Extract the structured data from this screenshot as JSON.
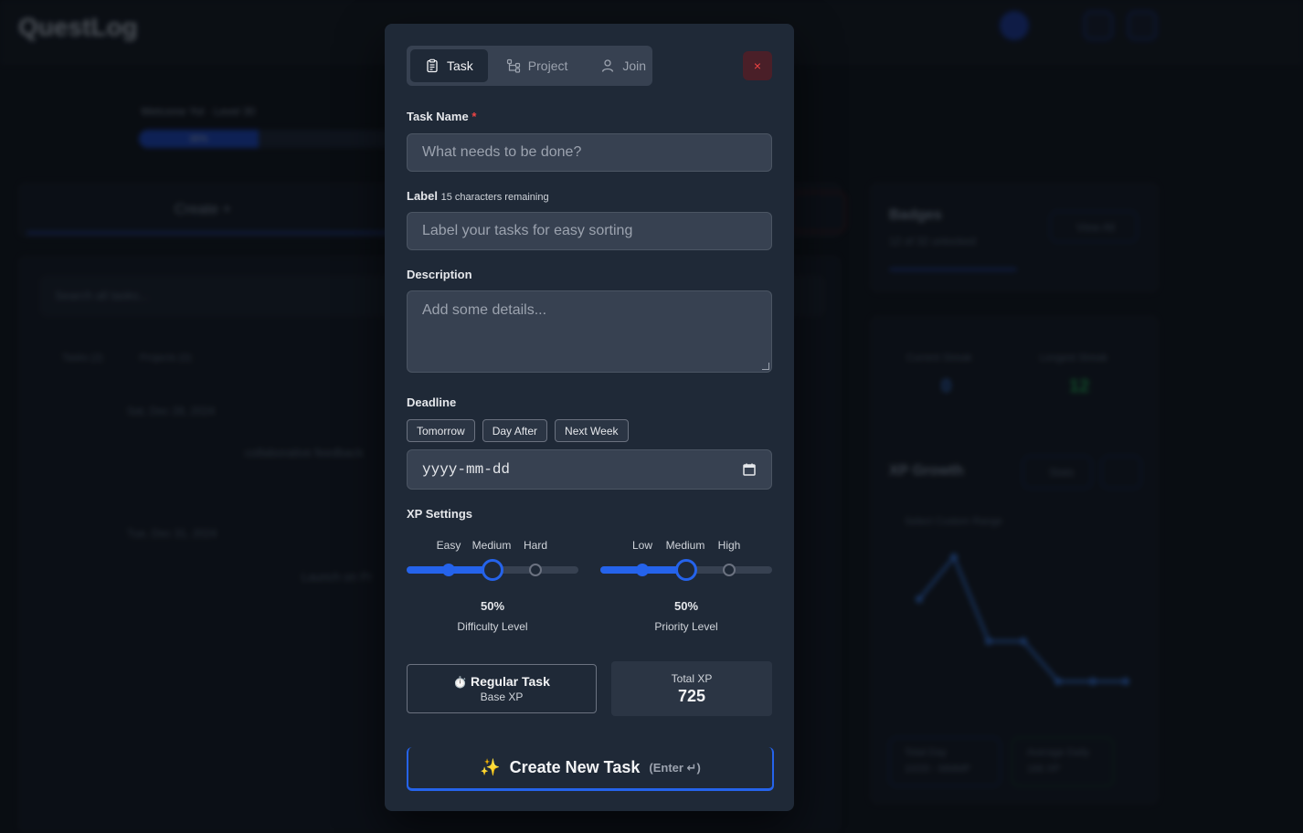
{
  "background": {
    "app_title": "QuestLog",
    "welcome_text": "Welcome Yol · Level 30",
    "progress_text": "36%",
    "create_tab": "Create +",
    "search_placeholder": "Search all tasks...",
    "filter_tasks": "Tasks (2)",
    "filter_projects": "Projects (0)",
    "date_1": "Sat, Dec 28, 2024",
    "task_1": "collaborative feedback",
    "date_2": "Tue, Dec 31, 2024",
    "task_2": "Launch on Pr",
    "badges_title": "Badges",
    "badges_sub": "12 of 32 unlocked",
    "view_all": "View All",
    "current_streak_label": "Current Streak",
    "current_streak_value": "0",
    "longest_streak_label": "Longest Streak",
    "longest_streak_value": "12",
    "xp_growth_title": "XP Growth",
    "stats_button": "Stats",
    "range_select": "Select Custom Range",
    "total_day_label": "Total Day",
    "total_day_value": "10/20 - MMMP",
    "average_daily_label": "Average Daily",
    "average_daily_value": "166 XP"
  },
  "modal": {
    "tabs": [
      {
        "label": "Task",
        "icon": "clipboard-icon",
        "active": true
      },
      {
        "label": "Project",
        "icon": "project-tree-icon",
        "active": false
      },
      {
        "label": "Join",
        "icon": "user-icon",
        "active": false
      }
    ],
    "close_symbol": "×",
    "task_name": {
      "label": "Task Name",
      "required_mark": "*",
      "placeholder": "What needs to be done?"
    },
    "label_field": {
      "label": "Label",
      "hint": "15 characters remaining",
      "placeholder": "Label your tasks for easy sorting"
    },
    "description": {
      "label": "Description",
      "placeholder": "Add some details..."
    },
    "deadline": {
      "label": "Deadline",
      "quick_options": [
        "Tomorrow",
        "Day After",
        "Next Week"
      ],
      "date_placeholder": "yyyy-mm-dd"
    },
    "xp_settings": {
      "label": "XP Settings",
      "difficulty": {
        "stops": [
          "Easy",
          "Medium",
          "Hard"
        ],
        "value": 0.5,
        "percent_text": "50%",
        "level_label": "Difficulty Level"
      },
      "priority": {
        "stops": [
          "Low",
          "Medium",
          "High"
        ],
        "value": 0.5,
        "percent_text": "50%",
        "level_label": "Priority Level"
      }
    },
    "task_type": {
      "icon": "⏱️",
      "title": "Regular Task",
      "subtitle": "Base XP"
    },
    "total_xp": {
      "label": "Total XP",
      "value": "725"
    },
    "create_button": {
      "icon": "✨",
      "label": "Create New Task",
      "hint": "(Enter ↵)"
    }
  },
  "colors": {
    "accent": "#2563eb",
    "danger": "#ef4444",
    "panel": "#1f2937",
    "input": "#374151"
  }
}
